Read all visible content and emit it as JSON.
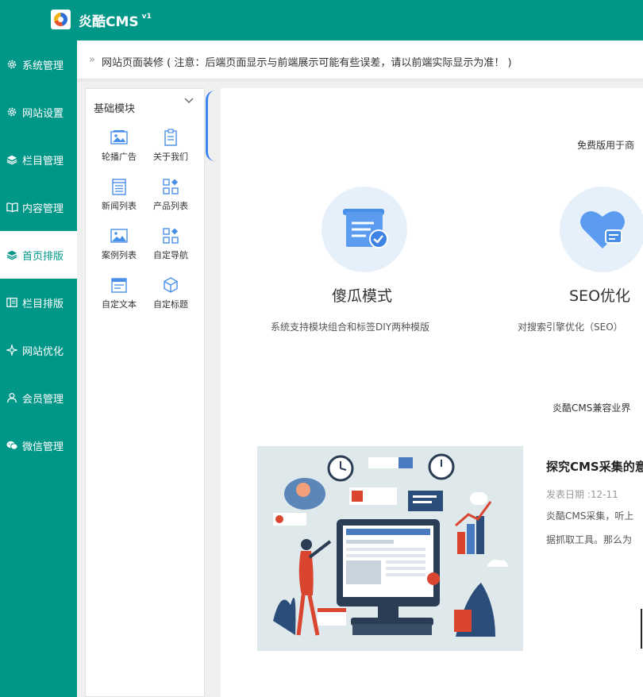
{
  "app": {
    "name": "炎酷CMS",
    "version": "v1"
  },
  "sidebar": {
    "items": [
      {
        "label": "系统管理",
        "icon": "gear-icon"
      },
      {
        "label": "网站设置",
        "icon": "gear-icon"
      },
      {
        "label": "栏目管理",
        "icon": "layers-icon"
      },
      {
        "label": "内容管理",
        "icon": "book-icon"
      },
      {
        "label": "首页排版",
        "icon": "layers-icon",
        "active": true
      },
      {
        "label": "栏目排版",
        "icon": "columns-icon"
      },
      {
        "label": "网站优化",
        "icon": "sparkle-icon"
      },
      {
        "label": "会员管理",
        "icon": "user-icon"
      },
      {
        "label": "微信管理",
        "icon": "wechat-icon"
      }
    ]
  },
  "breadcrumb": {
    "arrow": "»",
    "text": "网站页面装修 ( 注意：后端页面显示与前端展示可能有些误差，请以前端实际显示为准！ )"
  },
  "modules": {
    "title": "基础模块",
    "items": [
      {
        "label": "轮播广告",
        "icon": "image-icon"
      },
      {
        "label": "关于我们",
        "icon": "clipboard-icon"
      },
      {
        "label": "新闻列表",
        "icon": "list-icon"
      },
      {
        "label": "产品列表",
        "icon": "grid-icon"
      },
      {
        "label": "案例列表",
        "icon": "picture-icon"
      },
      {
        "label": "自定导航",
        "icon": "grid-icon"
      },
      {
        "label": "自定文本",
        "icon": "text-block-icon"
      },
      {
        "label": "自定标题",
        "icon": "cube-icon"
      }
    ]
  },
  "preview": {
    "free_note": "免费版用于商",
    "features": [
      {
        "title": "傻瓜模式",
        "desc": "系统支持模块组合和标签DIY两种模版"
      },
      {
        "title": "SEO优化",
        "desc": "对搜索引擎优化（SEO）"
      }
    ],
    "compat_note": "炎酷CMS兼容业界",
    "article": {
      "title": "探究CMS采集的意",
      "date": "发表日期 :12-11",
      "line1": "炎酷CMS采集，听上",
      "line2": "据抓取工具。那么为"
    }
  },
  "colors": {
    "primary": "#009688",
    "accent": "#3b82f6",
    "feature_bg": "#e6f0fb"
  }
}
